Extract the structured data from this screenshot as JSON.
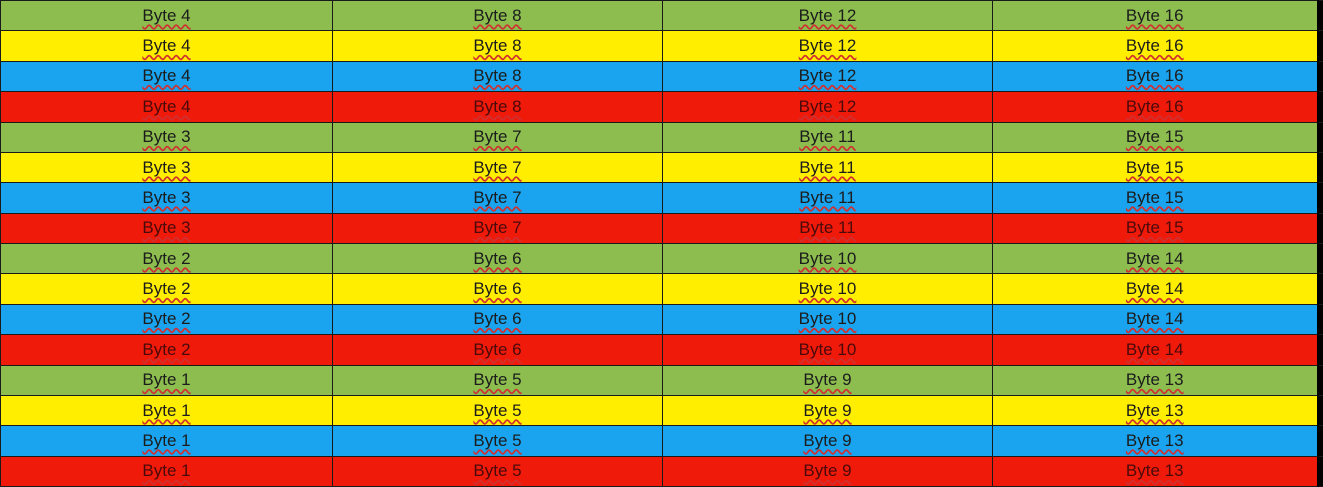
{
  "colors": {
    "green": "#8cbd4e",
    "yellow": "#ffee00",
    "blue": "#1aa3ee",
    "red": "#ef1a0a"
  },
  "rows": [
    {
      "color": "green",
      "cells": [
        "Byte 4",
        "Byte 8",
        "Byte 12",
        "Byte 16"
      ]
    },
    {
      "color": "yellow",
      "cells": [
        "Byte 4",
        "Byte 8",
        "Byte 12",
        "Byte 16"
      ]
    },
    {
      "color": "blue",
      "cells": [
        "Byte 4",
        "Byte 8",
        "Byte 12",
        "Byte 16"
      ]
    },
    {
      "color": "red",
      "cells": [
        "Byte 4",
        "Byte 8",
        "Byte 12",
        "Byte 16"
      ]
    },
    {
      "color": "green",
      "cells": [
        "Byte 3",
        "Byte 7",
        "Byte 11",
        "Byte 15"
      ]
    },
    {
      "color": "yellow",
      "cells": [
        "Byte 3",
        "Byte 7",
        "Byte 11",
        "Byte 15"
      ]
    },
    {
      "color": "blue",
      "cells": [
        "Byte 3",
        "Byte 7",
        "Byte 11",
        "Byte 15"
      ]
    },
    {
      "color": "red",
      "cells": [
        "Byte 3",
        "Byte 7",
        "Byte 11",
        "Byte 15"
      ]
    },
    {
      "color": "green",
      "cells": [
        "Byte 2",
        "Byte 6",
        "Byte 10",
        "Byte 14"
      ]
    },
    {
      "color": "yellow",
      "cells": [
        "Byte 2",
        "Byte 6",
        "Byte 10",
        "Byte 14"
      ]
    },
    {
      "color": "blue",
      "cells": [
        "Byte 2",
        "Byte 6",
        "Byte 10",
        "Byte 14"
      ]
    },
    {
      "color": "red",
      "cells": [
        "Byte 2",
        "Byte 6",
        "Byte 10",
        "Byte 14"
      ]
    },
    {
      "color": "green",
      "cells": [
        "Byte 1",
        "Byte 5",
        "Byte 9",
        "Byte 13"
      ]
    },
    {
      "color": "yellow",
      "cells": [
        "Byte 1",
        "Byte 5",
        "Byte 9",
        "Byte 13"
      ]
    },
    {
      "color": "blue",
      "cells": [
        "Byte 1",
        "Byte 5",
        "Byte 9",
        "Byte 13"
      ]
    },
    {
      "color": "red",
      "cells": [
        "Byte 1",
        "Byte 5",
        "Byte 9",
        "Byte 13"
      ]
    }
  ]
}
